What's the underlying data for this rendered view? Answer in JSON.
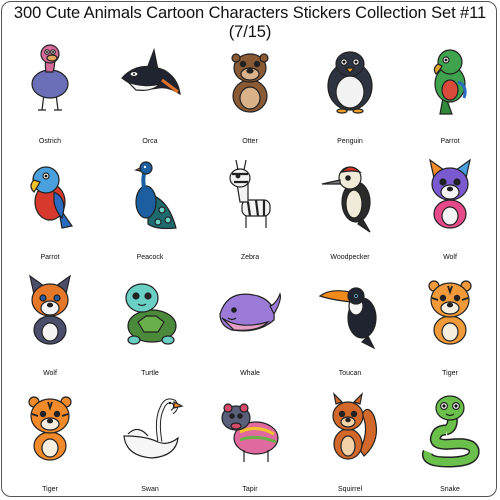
{
  "title": "300 Cute Animals Cartoon Characters Stickers Collection Set #11 (7/15)",
  "stickers": [
    {
      "label": "Ostrich",
      "icon": "ostrich-icon"
    },
    {
      "label": "Orca",
      "icon": "orca-icon"
    },
    {
      "label": "Otter",
      "icon": "otter-icon"
    },
    {
      "label": "Penguin",
      "icon": "penguin-icon"
    },
    {
      "label": "Parrot",
      "icon": "parrot-icon"
    },
    {
      "label": "Parrot",
      "icon": "parrot-icon"
    },
    {
      "label": "Peacock",
      "icon": "peacock-icon"
    },
    {
      "label": "Zebra",
      "icon": "zebra-icon"
    },
    {
      "label": "Woodpecker",
      "icon": "woodpecker-icon"
    },
    {
      "label": "Wolf",
      "icon": "wolf-icon"
    },
    {
      "label": "Wolf",
      "icon": "wolf-icon"
    },
    {
      "label": "Turtle",
      "icon": "turtle-icon"
    },
    {
      "label": "Whale",
      "icon": "whale-icon"
    },
    {
      "label": "Toucan",
      "icon": "toucan-icon"
    },
    {
      "label": "Tiger",
      "icon": "tiger-icon"
    },
    {
      "label": "Tiger",
      "icon": "tiger-icon"
    },
    {
      "label": "Swan",
      "icon": "swan-icon"
    },
    {
      "label": "Tapir",
      "icon": "tapir-icon"
    },
    {
      "label": "Squirrel",
      "icon": "squirrel-icon"
    },
    {
      "label": "Snake",
      "icon": "snake-icon"
    }
  ]
}
